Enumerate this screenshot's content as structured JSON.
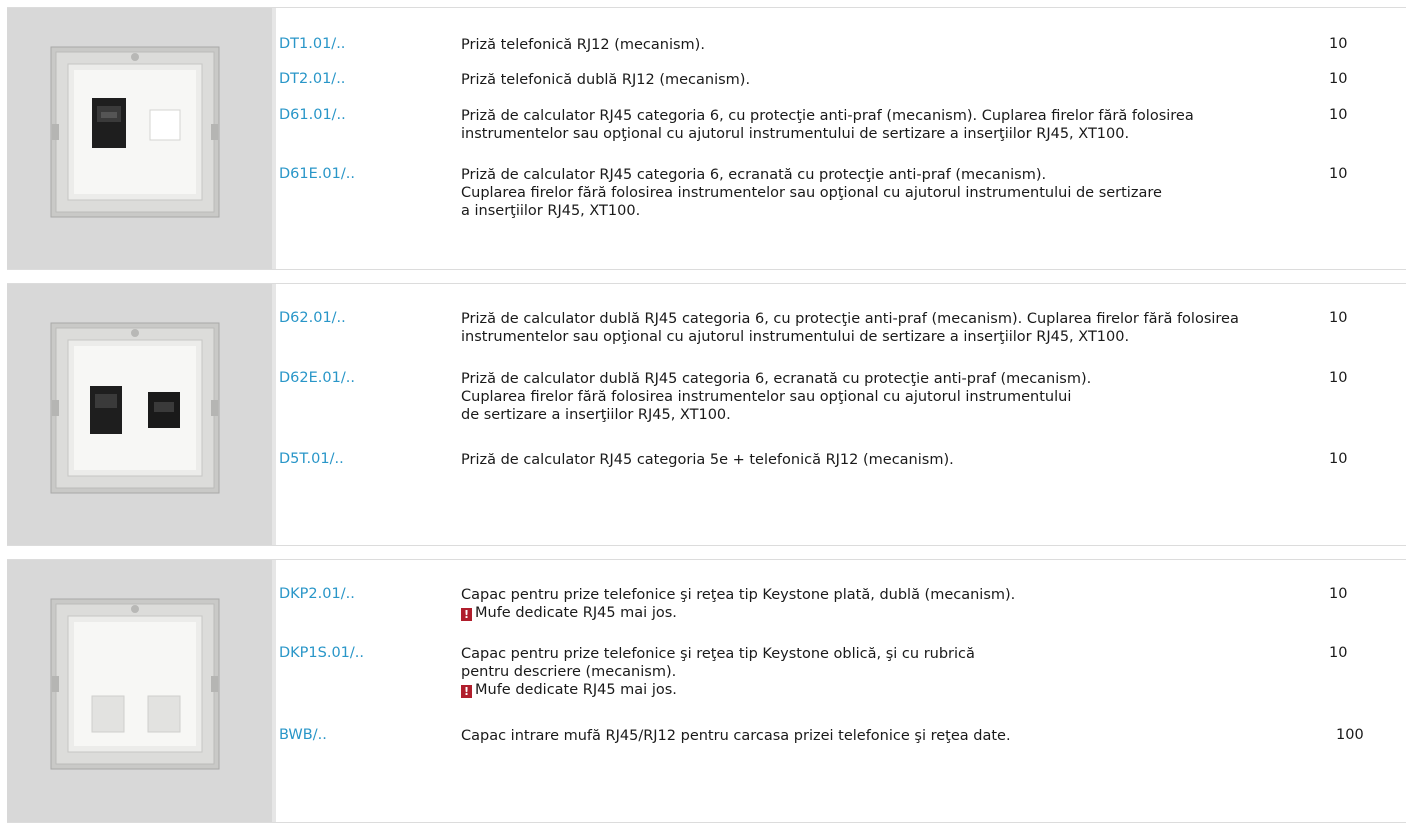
{
  "sections": [
    {
      "image": "single RJ45 + RJ12 socket mechanism in frame",
      "rows": [
        {
          "code": "DT1.01/..",
          "lines": [
            "Priză telefonică RJ12 (mecanism)."
          ],
          "qty": "10"
        },
        {
          "code": "DT2.01/..",
          "lines": [
            "Priză telefonică dublă RJ12 (mecanism)."
          ],
          "qty": "10"
        },
        {
          "code": "D61.01/..",
          "lines": [
            "Priză de calculator RJ45 categoria 6, cu protecţie anti-praf (mecanism). Cuplarea firelor fără folosirea",
            "instrumentelor sau opţional cu ajutorul instrumentului de sertizare a inserţiilor RJ45, XT100."
          ],
          "qty": "10"
        },
        {
          "code": "D61E.01/..",
          "lines": [
            "Priză de calculator RJ45 categoria 6, ecranată cu protecţie anti-praf (mecanism).",
            "Cuplarea firelor fără folosirea instrumentelor sau opţional cu ajutorul instrumentului de sertizare",
            "a inserţiilor RJ45, XT100."
          ],
          "qty": "10"
        }
      ]
    },
    {
      "image": "double RJ45 socket mechanism in frame",
      "rows": [
        {
          "code": "D62.01/..",
          "lines": [
            "Priză de calculator dublă RJ45 categoria 6, cu protecţie anti-praf (mecanism). Cuplarea firelor fără folosirea",
            "instrumentelor sau opţional cu ajutorul instrumentului de sertizare a inserţiilor RJ45, XT100."
          ],
          "qty": "10"
        },
        {
          "code": "D62E.01/..",
          "lines": [
            "Priză de calculator dublă RJ45 categoria 6, ecranată cu protecţie anti-praf (mecanism).",
            "Cuplarea firelor fără folosirea instrumentelor sau opţional cu ajutorul instrumentului",
            "de sertizare a inserţiilor RJ45, XT100."
          ],
          "qty": "10"
        },
        {
          "code": "D5T.01/..",
          "lines": [
            "Priză de calculator RJ45 categoria 5e + telefonică RJ12 (mecanism)."
          ],
          "qty": "10"
        }
      ]
    },
    {
      "image": "keystone cover plate with two blank inserts",
      "rows": [
        {
          "code": "DKP2.01/..",
          "lines": [
            "Capac pentru prize telefonice şi reţea tip Keystone plată, dublă (mecanism)."
          ],
          "warning": "Mufe dedicate RJ45 mai jos.",
          "qty": "10"
        },
        {
          "code": "DKP1S.01/..",
          "lines": [
            "Capac pentru prize telefonice şi reţea tip Keystone oblică, şi cu rubrică",
            "pentru descriere (mecanism)."
          ],
          "warning": "Mufe dedicate RJ45 mai jos.",
          "qty": "10"
        },
        {
          "code": "BWB/..",
          "lines": [
            "Capac intrare mufă RJ45/RJ12 pentru carcasa prizei telefonice şi reţea date."
          ],
          "qty": "100"
        }
      ]
    }
  ],
  "icons": {
    "warning": "!"
  },
  "colors": {
    "code": "#2996c8",
    "warning": "#b01e2c",
    "panel": "#d8d8d8"
  }
}
